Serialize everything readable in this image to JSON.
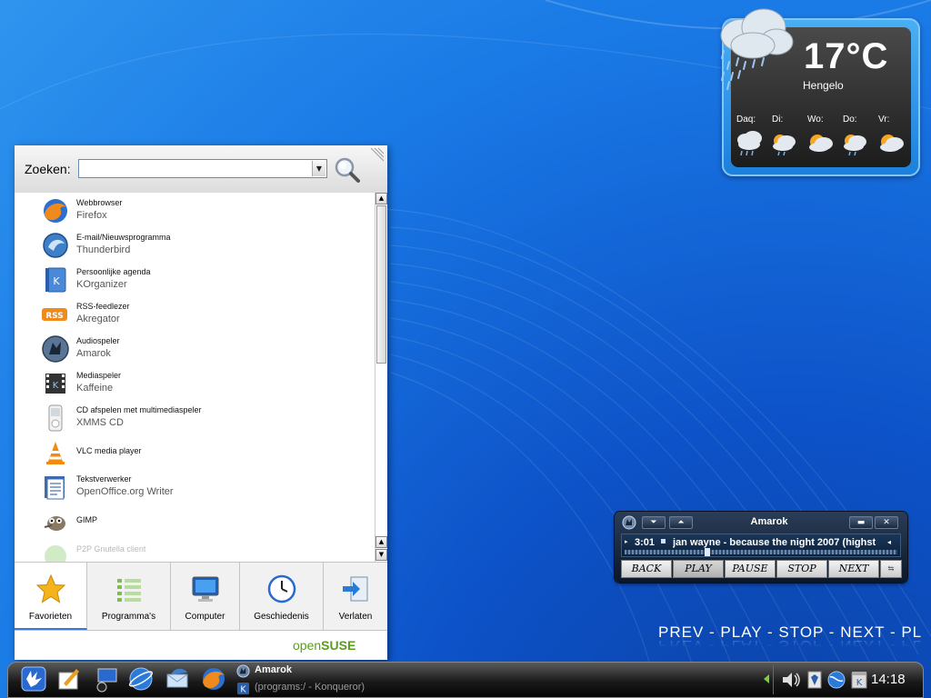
{
  "weather": {
    "temperature": "17°C",
    "city": "Hengelo",
    "days": [
      "Daq:",
      "Di:",
      "Wo:",
      "Do:",
      "Vr:"
    ]
  },
  "menu": {
    "search_label": "Zoeken:",
    "search_value": "",
    "apps": [
      {
        "title": "Webbrowser",
        "subtitle": "Firefox",
        "icon": "firefox-icon"
      },
      {
        "title": "E-mail/Nieuwsprogramma",
        "subtitle": "Thunderbird",
        "icon": "thunderbird-icon"
      },
      {
        "title": "Persoonlijke agenda",
        "subtitle": "KOrganizer",
        "icon": "korganizer-icon"
      },
      {
        "title": "RSS-feedlezer",
        "subtitle": "Akregator",
        "icon": "rss-icon"
      },
      {
        "title": "Audiospeler",
        "subtitle": "Amarok",
        "icon": "amarok-icon"
      },
      {
        "title": "Mediaspeler",
        "subtitle": "Kaffeine",
        "icon": "kaffeine-icon"
      },
      {
        "title": "CD afspelen met multimediaspeler",
        "subtitle": "XMMS CD",
        "icon": "ipod-icon"
      },
      {
        "title": "VLC media player",
        "subtitle": "",
        "icon": "vlc-icon"
      },
      {
        "title": "Tekstverwerker",
        "subtitle": "OpenOffice.org Writer",
        "icon": "writer-icon"
      },
      {
        "title": "GIMP",
        "subtitle": "",
        "icon": "gimp-icon"
      },
      {
        "title": "P2P Gnutella client",
        "subtitle": "",
        "icon": "gnutella-icon"
      }
    ],
    "tabs": [
      {
        "label": "Favorieten",
        "icon": "star-icon"
      },
      {
        "label": "Programma's",
        "icon": "programs-list-icon"
      },
      {
        "label": "Computer",
        "icon": "monitor-icon"
      },
      {
        "label": "Geschiedenis",
        "icon": "clock-icon"
      },
      {
        "label": "Verlaten",
        "icon": "logout-icon"
      }
    ],
    "active_tab": "Favorieten",
    "footer_brand_a": "open",
    "footer_brand_b": "SUSE"
  },
  "amarok": {
    "title": "Amarok",
    "time": "3:01",
    "track": "jan wayne - because the night 2007 (highst",
    "controls": [
      "BACK",
      "PLAY",
      "PAUSE",
      "STOP",
      "NEXT"
    ],
    "active_control": "PLAY",
    "progress": 0.3
  },
  "osd": {
    "text": "PREV - PLAY - STOP - NEXT - PL"
  },
  "taskbar": {
    "tasks": [
      {
        "label": "Amarok",
        "active": true
      },
      {
        "label": "(programs:/ - Konqueror)",
        "active": false
      }
    ],
    "clock": "14:18"
  },
  "colors": {
    "desktop": "#1a7ae6",
    "opensuse_green": "#5a9d1e",
    "taskbar": "#1a1a1a",
    "tray_arrow": "#7bcf3a"
  }
}
